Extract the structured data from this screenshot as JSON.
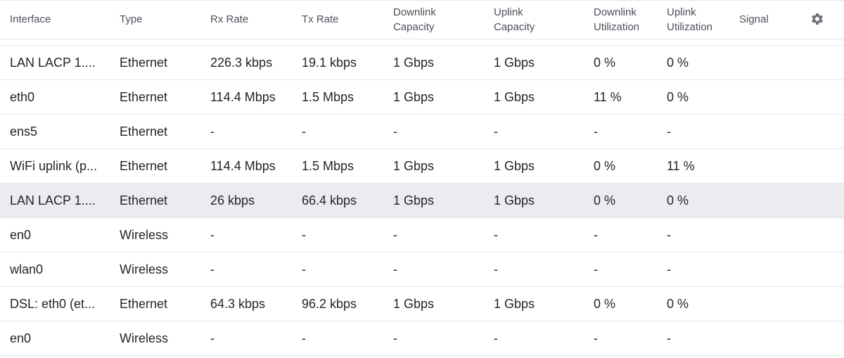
{
  "columns": [
    {
      "line1": "Interface",
      "line2": ""
    },
    {
      "line1": "Type",
      "line2": ""
    },
    {
      "line1": "Rx Rate",
      "line2": ""
    },
    {
      "line1": "Tx Rate",
      "line2": ""
    },
    {
      "line1": "Downlink",
      "line2": "Capacity"
    },
    {
      "line1": "Uplink",
      "line2": "Capacity"
    },
    {
      "line1": "Downlink",
      "line2": "Utilization"
    },
    {
      "line1": "Uplink",
      "line2": "Utilization"
    },
    {
      "line1": "Signal",
      "line2": ""
    }
  ],
  "settings_icon": "gear-icon",
  "rows": [
    {
      "interface": "LAN LACP 1....",
      "type": "Ethernet",
      "rx": "226.3 kbps",
      "tx": "19.1 kbps",
      "down_cap": "1 Gbps",
      "up_cap": "1 Gbps",
      "down_util": "0 %",
      "up_util": "0 %",
      "signal": ""
    },
    {
      "interface": "eth0",
      "type": "Ethernet",
      "rx": "114.4 Mbps",
      "tx": "1.5 Mbps",
      "down_cap": "1 Gbps",
      "up_cap": "1 Gbps",
      "down_util": "11 %",
      "up_util": "0 %",
      "signal": ""
    },
    {
      "interface": "ens5",
      "type": "Ethernet",
      "rx": "-",
      "tx": "-",
      "down_cap": "-",
      "up_cap": "-",
      "down_util": "-",
      "up_util": "-",
      "signal": ""
    },
    {
      "interface": "WiFi uplink (p...",
      "type": "Ethernet",
      "rx": "114.4 Mbps",
      "tx": "1.5 Mbps",
      "down_cap": "1 Gbps",
      "up_cap": "1 Gbps",
      "down_util": "0 %",
      "up_util": "11 %",
      "signal": ""
    },
    {
      "interface": "LAN LACP 1....",
      "type": "Ethernet",
      "rx": "26 kbps",
      "tx": "66.4 kbps",
      "down_cap": "1 Gbps",
      "up_cap": "1 Gbps",
      "down_util": "0 %",
      "up_util": "0 %",
      "signal": "",
      "selected": true
    },
    {
      "interface": "en0",
      "type": "Wireless",
      "rx": "-",
      "tx": "-",
      "down_cap": "-",
      "up_cap": "-",
      "down_util": "-",
      "up_util": "-",
      "signal": ""
    },
    {
      "interface": "wlan0",
      "type": "Wireless",
      "rx": "-",
      "tx": "-",
      "down_cap": "-",
      "up_cap": "-",
      "down_util": "-",
      "up_util": "-",
      "signal": ""
    },
    {
      "interface": "DSL: eth0 (et...",
      "type": "Ethernet",
      "rx": "64.3 kbps",
      "tx": "96.2 kbps",
      "down_cap": "1 Gbps",
      "up_cap": "1 Gbps",
      "down_util": "0 %",
      "up_util": "0 %",
      "signal": ""
    },
    {
      "interface": "en0",
      "type": "Wireless",
      "rx": "-",
      "tx": "-",
      "down_cap": "-",
      "up_cap": "-",
      "down_util": "-",
      "up_util": "-",
      "signal": ""
    }
  ]
}
